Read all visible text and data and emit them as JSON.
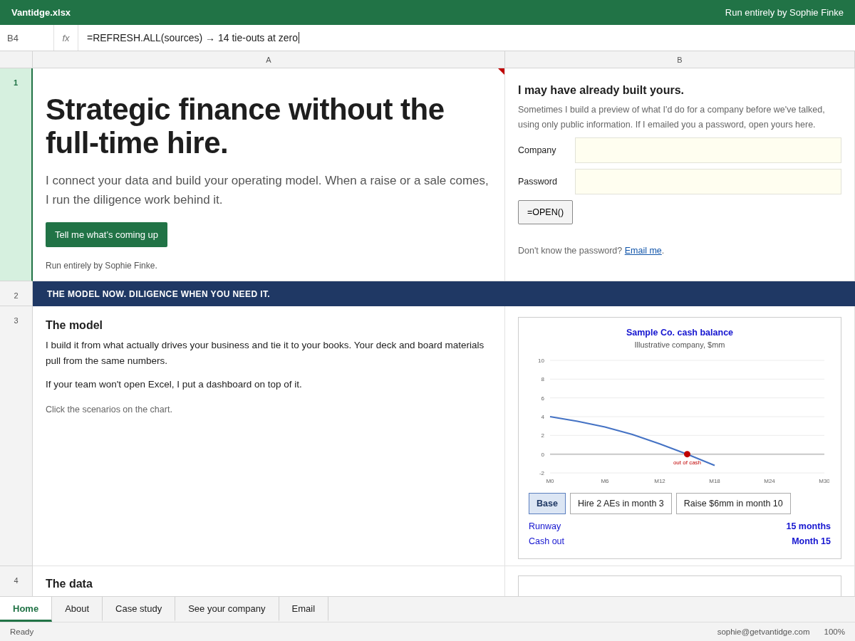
{
  "title_bar": {
    "file_name": "Vantidge.xlsx",
    "tagline": "Run entirely by Sophie Finke"
  },
  "formula_bar": {
    "cell_ref": "B4",
    "fx": "fx",
    "formula": "=REFRESH.ALL(sources) → 14 tie-outs at zero"
  },
  "columns": [
    "A",
    "B"
  ],
  "rows": [
    {
      "number": "1",
      "selected": true
    },
    {
      "number": "2",
      "selected": false
    },
    {
      "number": "3",
      "selected": false
    },
    {
      "number": "4",
      "selected": false
    }
  ],
  "hero": {
    "headline": "Strategic finance without the full-time hire.",
    "lede": "I connect your data and build your operating model. When a raise or a sale comes, I run the diligence work behind it.",
    "button": "Tell me what’s coming up",
    "byline": "Run entirely by Sophie Finke."
  },
  "preview": {
    "heading": "I may have already built yours.",
    "text": "Sometimes I build a preview of what I'd do for a company before we've talked, using only public information. If I emailed you a password, open yours here.",
    "fields": [
      {
        "label": "Company"
      },
      {
        "label": "Password"
      }
    ],
    "button": "=OPEN()",
    "help": "Don't know the password? ",
    "link": "Email me",
    "help_end": "."
  },
  "banner": "THE MODEL NOW. DILIGENCE WHEN YOU NEED IT.",
  "model": {
    "heading": "The model",
    "paragraphs": [
      "I build it from what actually drives your business and tie it to your books. Your deck and board materials pull from the same numbers.",
      "If your team won't open Excel, I put a dashboard on top of it."
    ],
    "note": "Click the scenarios on the chart."
  },
  "chart_card": {
    "subtitle": "Illustrative company, $mm",
    "chart_data": {
      "type": "line",
      "title": "Sample Co. cash balance",
      "categories": [
        "M0",
        null,
        "M6",
        null,
        "M12",
        null,
        "M18",
        null,
        "M24",
        null,
        "M30"
      ],
      "series": [
        {
          "color": "#4472c4",
          "values": [
            4.0,
            3.5,
            2.9,
            2.1,
            1.1,
            0,
            -1.2,
            null,
            null,
            null,
            null
          ]
        }
      ],
      "ylim": [
        -2,
        10
      ],
      "grid": true,
      "yticks": [
        -2,
        0,
        2,
        4,
        6,
        8,
        10
      ],
      "annotations": [
        {
          "y": 0,
          "text": "out of cash"
        }
      ]
    },
    "scenarios": [
      {
        "label": "Base",
        "selected": true
      },
      {
        "label": "Hire 2 AEs in month 3",
        "selected": false
      },
      {
        "label": "Raise $6mm in month 10",
        "selected": false
      }
    ],
    "metrics": [
      {
        "label": "Runway",
        "value": "15 months"
      },
      {
        "label": "Cash out",
        "value": "Month 15"
      }
    ]
  },
  "data_section": {
    "heading": "The data"
  },
  "sheet_tabs": [
    {
      "label": "Home",
      "selected": true
    },
    {
      "label": "About",
      "selected": false
    },
    {
      "label": "Case study",
      "selected": false
    },
    {
      "label": "See your company",
      "selected": false
    },
    {
      "label": "Email",
      "selected": false
    }
  ],
  "status_bar": {
    "mode": "Ready",
    "email": "sophie@getvantidge.com",
    "zoom": "100%"
  }
}
